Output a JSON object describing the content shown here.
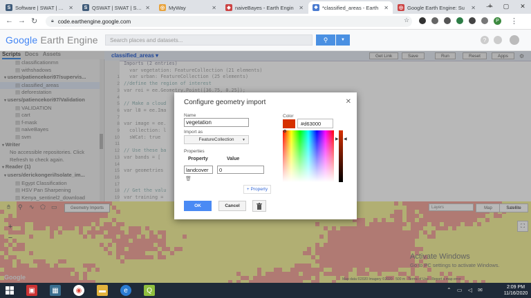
{
  "browser": {
    "tabs": [
      {
        "title": "Software | SWAT | Soil &",
        "favicon": "S",
        "color": "#3f5b7a",
        "active": false
      },
      {
        "title": "QSWAT | SWAT | Soil &",
        "favicon": "S",
        "color": "#3f5b7a",
        "active": false
      },
      {
        "title": "MyWay",
        "favicon": "◎",
        "color": "#e8a33d",
        "active": false
      },
      {
        "title": "naiveBayes - Earth Engin",
        "favicon": "◆",
        "color": "#c44",
        "active": false
      },
      {
        "title": "*classified_areas - Earth",
        "favicon": "❖",
        "color": "#4a7bd0",
        "active": true
      },
      {
        "title": "Google Earth Engine: Su",
        "favicon": "◎",
        "color": "#c44",
        "active": false
      }
    ],
    "new_tab": "+",
    "url": "code.earthengine.google.com",
    "profile_initial": "P"
  },
  "gee": {
    "logo_google": "Google",
    "logo_rest": " Earth Engine",
    "search_placeholder": "Search places and datasets...",
    "left_tabs": [
      "Scripts",
      "Docs",
      "Assets"
    ],
    "tree": [
      {
        "text": "classificationrnn",
        "indent": 22,
        "type": "file"
      },
      {
        "text": "withshadows",
        "indent": 22,
        "type": "file"
      },
      {
        "text": "users/patiencekori97/supervis...",
        "indent": 6,
        "type": "folder"
      },
      {
        "text": "classified_areas",
        "indent": 22,
        "type": "file",
        "selected": true
      },
      {
        "text": "deforestation",
        "indent": 22,
        "type": "file"
      },
      {
        "text": "users/patiencekori97/Validation",
        "indent": 6,
        "type": "folder"
      },
      {
        "text": "VALIDATION",
        "indent": 22,
        "type": "file"
      },
      {
        "text": "cart",
        "indent": 22,
        "type": "file"
      },
      {
        "text": "f-mask",
        "indent": 22,
        "type": "file"
      },
      {
        "text": "naiveBayes",
        "indent": 22,
        "type": "file"
      },
      {
        "text": "svm",
        "indent": 22,
        "type": "file"
      },
      {
        "text": "Writer",
        "indent": 3,
        "type": "section"
      },
      {
        "text": "No accessible repositories. Click",
        "indent": 14,
        "type": "note"
      },
      {
        "text": "Refresh to check again.",
        "indent": 14,
        "type": "note"
      },
      {
        "text": "Reader (1)",
        "indent": 3,
        "type": "section"
      },
      {
        "text": "users/derickongeri/Isolate_im...",
        "indent": 6,
        "type": "folder"
      },
      {
        "text": "Egypt Classification",
        "indent": 22,
        "type": "file"
      },
      {
        "text": "HSV Pan Sharpening",
        "indent": 22,
        "type": "file"
      },
      {
        "text": "Kenya_sentinel2_download",
        "indent": 22,
        "type": "file"
      }
    ],
    "editor": {
      "title": "classified_areas",
      "buttons": [
        "Get Link",
        "Save",
        "Run",
        "Reset",
        "Apps"
      ],
      "line_numbers": [
        "",
        "",
        "1",
        "2",
        "3",
        "4",
        "5",
        "6",
        "7",
        "8",
        "9",
        "10",
        "11",
        "12",
        "13",
        "14",
        "15",
        "16",
        "17",
        "18",
        "19"
      ],
      "code_lines": [
        "Imports (2 entries) ",
        "  var vegetation: FeatureCollection (21 elements)",
        "  var urban: FeatureCollection (25 elements)",
        "//define the region of interest",
        "var roi = ee.Geometry.Point([36.75, 0.25]);",
        "",
        "// Make a cloud",
        "var l8 = ee.Ima",
        "",
        "var image = ee.",
        "  collection: l",
        "  sWCat: true",
        "",
        "// Use these ba",
        "var bands = [",
        "",
        "var geometries",
        "",
        "",
        "// Get the valu",
        "var training =",
        "  // Get the va"
      ]
    },
    "map": {
      "geometry_imports": "Geometry Imports",
      "layers": "Layers",
      "map_btn": "Map",
      "satellite_btn": "Satellite",
      "zoom_in": "+",
      "zoom_out": "−",
      "activate_title": "Activate Windows",
      "activate_sub": "Go to PC settings to activate Windows.",
      "attribution": "Map data ©2020 Imagery ©2020 · 500 m · Terms of Use · Report a map error",
      "google_mark": "Google"
    }
  },
  "dialog": {
    "title": "Configure geometry import",
    "close": "✕",
    "name_label": "Name",
    "name_value": "vegetation",
    "import_as_label": "Import as",
    "import_as_value": "FeatureCollection",
    "properties_label": "Properties",
    "property_header": "Property",
    "value_header": "Value",
    "property_name": "landcover",
    "property_value": "0",
    "add_property": "+ Property",
    "ok": "OK",
    "cancel": "Cancel",
    "color_label": "Color",
    "color_hex": "#d63000"
  },
  "taskbar": {
    "time": "2:09 PM",
    "date": "11/16/2020"
  },
  "colors": {
    "accent": "#4a8af4",
    "selected_color": "#d63000",
    "map_urban": "#f4a9a0",
    "map_veg": "#f6f3a0"
  }
}
